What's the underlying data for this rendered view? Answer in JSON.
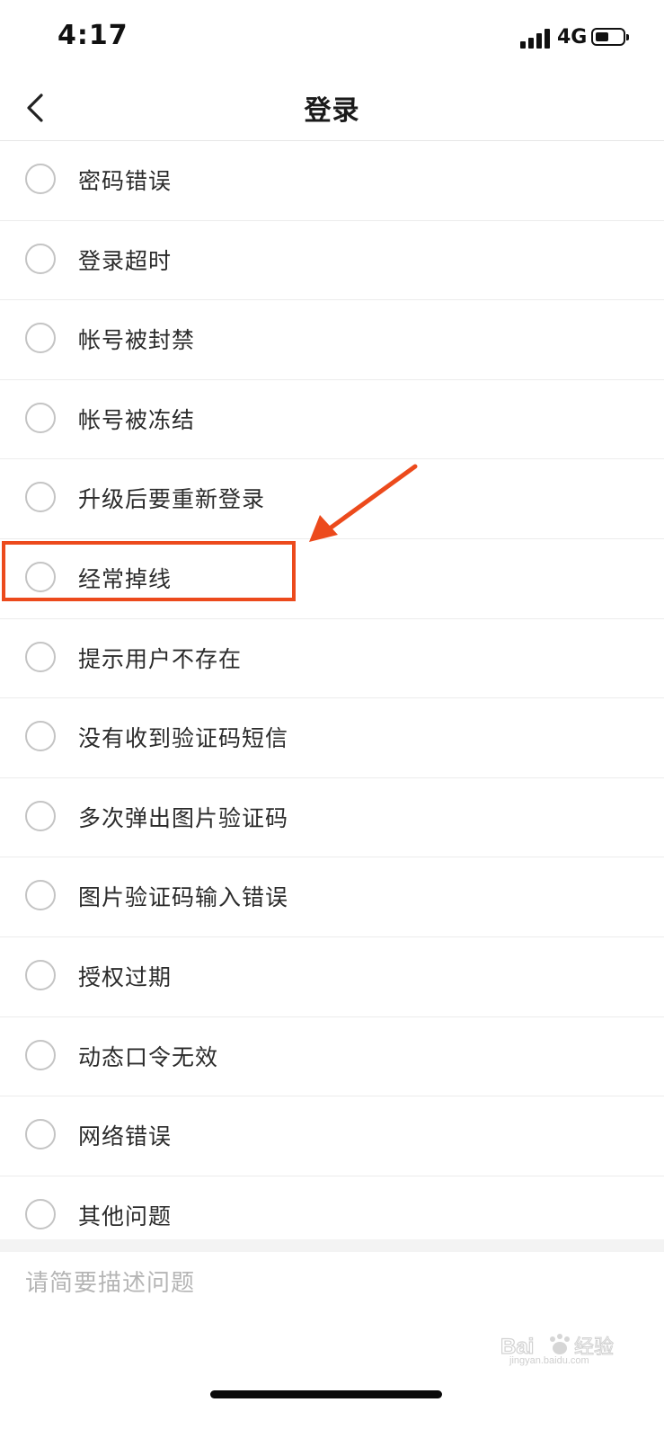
{
  "status_bar": {
    "time": "4:17",
    "network": "4G"
  },
  "nav": {
    "title": "登录",
    "back_icon": "chevron-left-icon"
  },
  "options": [
    {
      "label": "密码错误"
    },
    {
      "label": "登录超时"
    },
    {
      "label": "帐号被封禁"
    },
    {
      "label": "帐号被冻结"
    },
    {
      "label": "升级后要重新登录"
    },
    {
      "label": "经常掉线"
    },
    {
      "label": "提示用户不存在"
    },
    {
      "label": "没有收到验证码短信"
    },
    {
      "label": "多次弹出图片验证码"
    },
    {
      "label": "图片验证码输入错误"
    },
    {
      "label": "授权过期"
    },
    {
      "label": "动态口令无效"
    },
    {
      "label": "网络错误"
    },
    {
      "label": "其他问题"
    }
  ],
  "description": {
    "placeholder": "请简要描述问题",
    "value": ""
  },
  "annotation": {
    "color": "#ec4a1c"
  },
  "watermark": {
    "text": "jingyan.baidu.com"
  }
}
